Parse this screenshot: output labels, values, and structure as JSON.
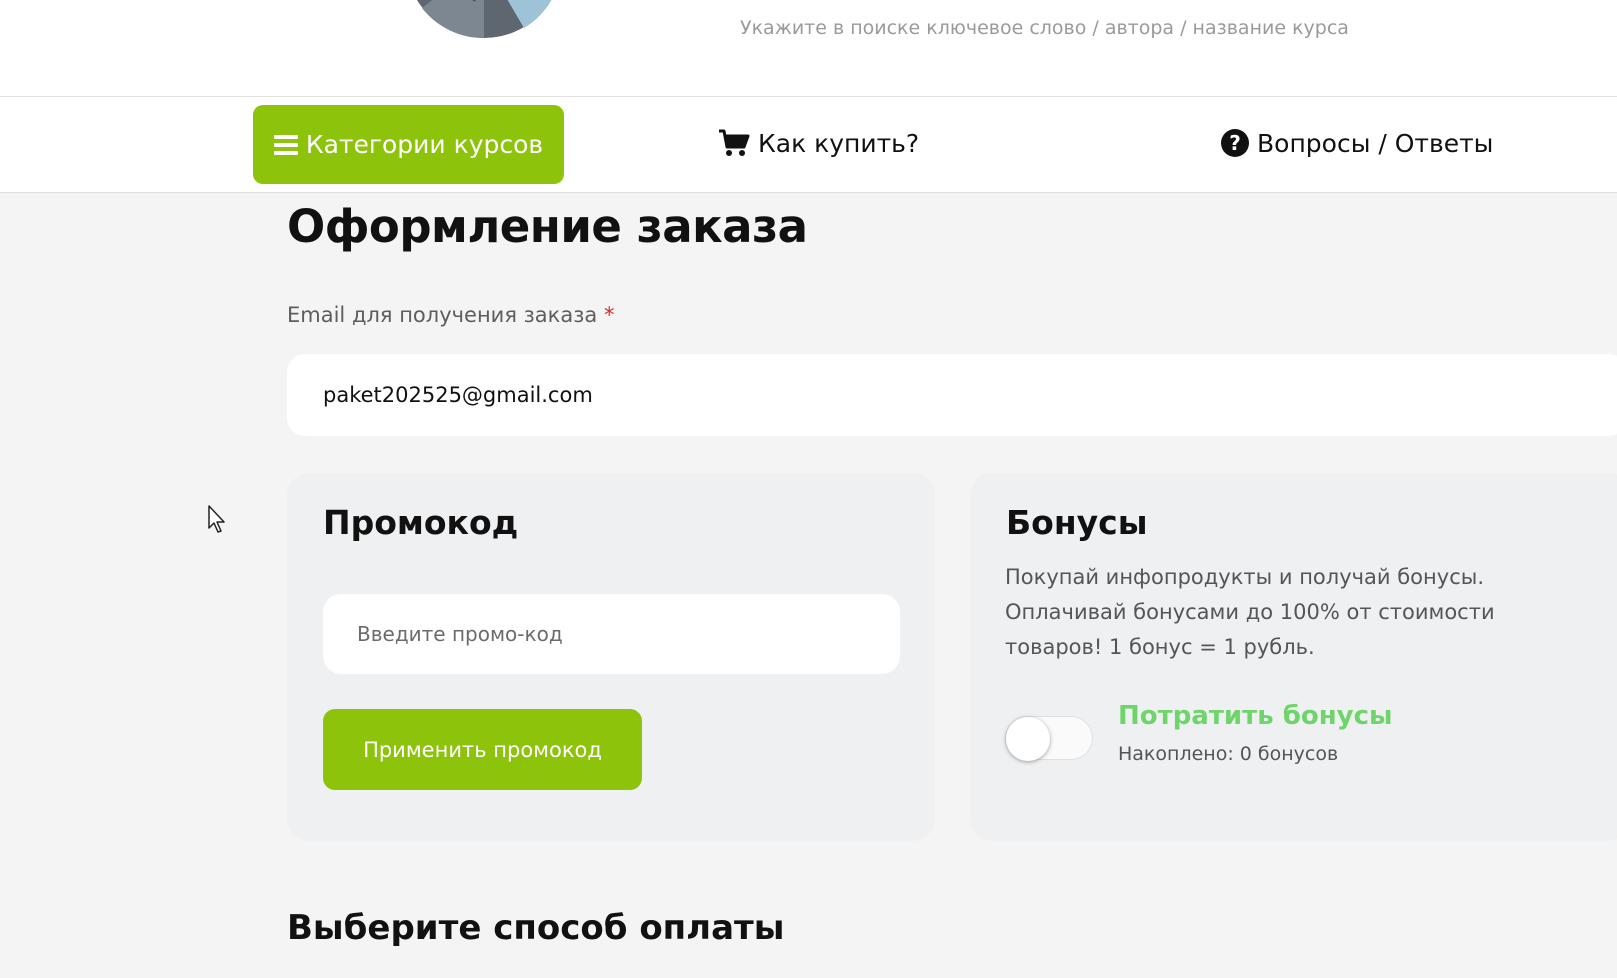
{
  "header": {
    "search": {
      "placeholder": "Укажите в поиске ключевое слово / автора / название курса"
    }
  },
  "nav": {
    "categories_label": "Категории курсов",
    "how_to_buy_label": "Как купить?",
    "faq_label": "Вопросы / Ответы",
    "faq_icon_glyph": "?"
  },
  "checkout": {
    "title": "Оформление заказа",
    "email_label": "Email для получения заказа",
    "required_mark": "*",
    "email_value": "paket202525@gmail.com"
  },
  "promo": {
    "title": "Промокод",
    "placeholder": "Введите промо-код",
    "apply_label": "Применить промокод"
  },
  "bonus": {
    "title": "Бонусы",
    "description": "Покупай инфопродукты и получай бонусы. Оплачивай бонусами до 100% от стоимости товаров! 1 бонус = 1 рубль.",
    "spend_label": "Потратить бонусы",
    "accumulated_label": "Накоплено: 0 бонусов",
    "toggle_on": false
  },
  "payment": {
    "title": "Выберите способ оплаты"
  },
  "colors": {
    "accent_green": "#8dc30a",
    "bonus_green": "#6fd46a",
    "required_red": "#d62a2a"
  },
  "icons": {
    "menu": "hamburger-menu-icon",
    "cart": "shopping-cart-icon",
    "faq": "question-circle-icon"
  }
}
